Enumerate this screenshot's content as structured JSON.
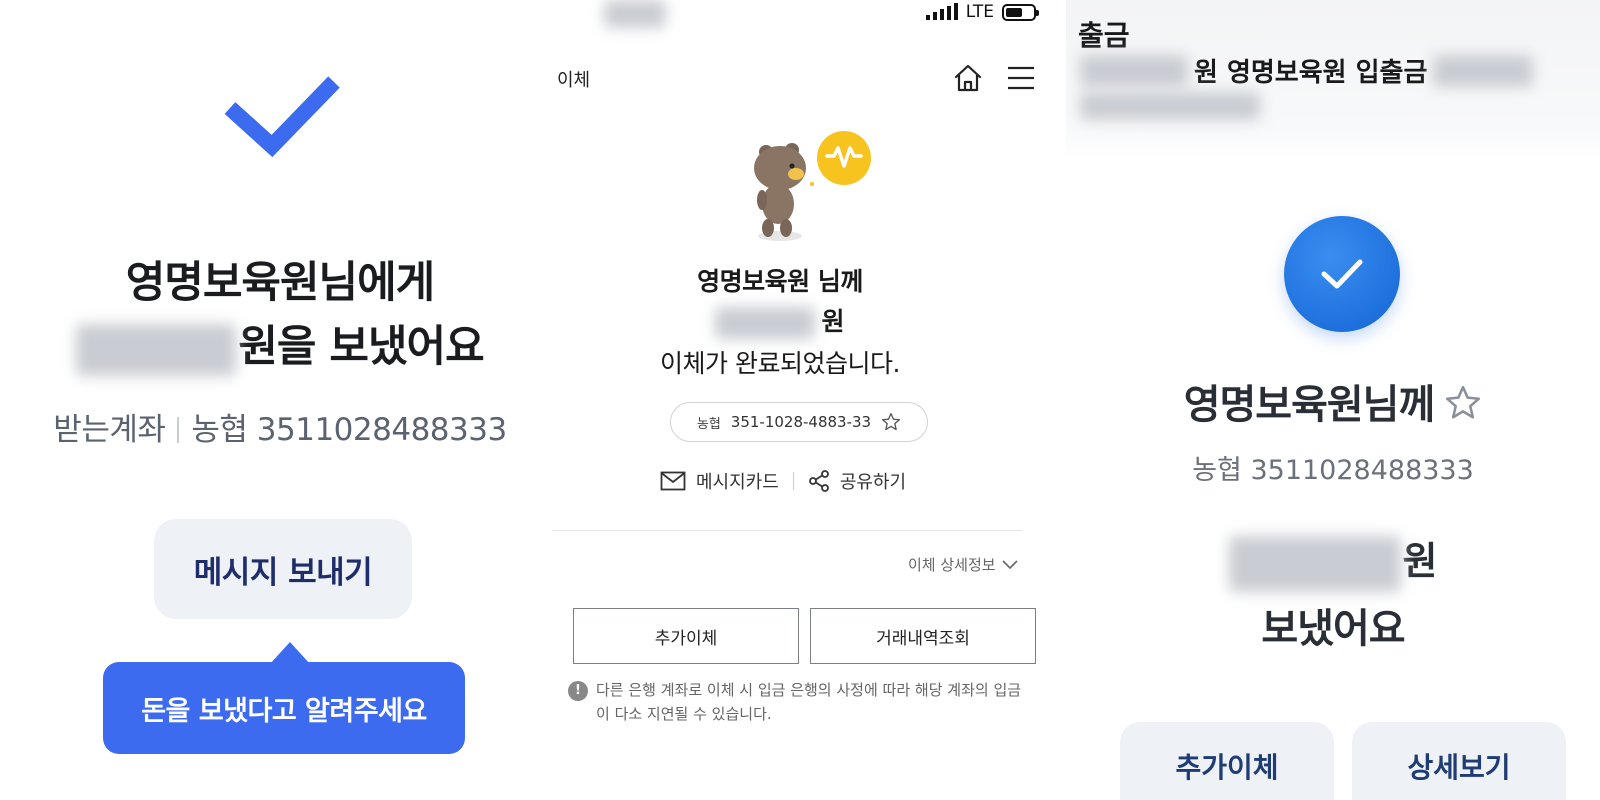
{
  "panel_toss": {
    "title_line1": "영명보육원님에게",
    "title_line2_suffix": "원을 보냈어요",
    "account_label": "받는계좌",
    "account_value": "농협 3511028488333",
    "send_message_button": "메시지 보내기",
    "tooltip_text": "돈을 보냈다고 알려주세요",
    "accent_color": "#3d6bf0"
  },
  "panel_kakao": {
    "status_bar": {
      "network": "LTE"
    },
    "header_title": "이체",
    "recipient_line": "영명보육원 님께",
    "amount_suffix": "원",
    "complete_text": "이체가 완료되었습니다.",
    "account_bank": "농협",
    "account_number": "351-1028-4883-33",
    "message_card_label": "메시지카드",
    "share_label": "공유하기",
    "detail_label": "이체 상세정보",
    "additional_transfer_button": "추가이체",
    "history_button": "거래내역조회",
    "notice_text": "다른 은행 계좌로 이체 시 입금 은행의 사정에 따라 해당 계좌의 입금이 다소 지연될 수 있습니다."
  },
  "panel_bank": {
    "notification_title": "출금",
    "notification_body": "원 영명보육원 입출금",
    "recipient": "영명보육원님께",
    "account": "농협 3511028488333",
    "amount_suffix": "원",
    "sent_text": "보냈어요",
    "additional_transfer_button": "추가이체",
    "detail_button": "상세보기",
    "accent_color": "#1a6fe0"
  }
}
